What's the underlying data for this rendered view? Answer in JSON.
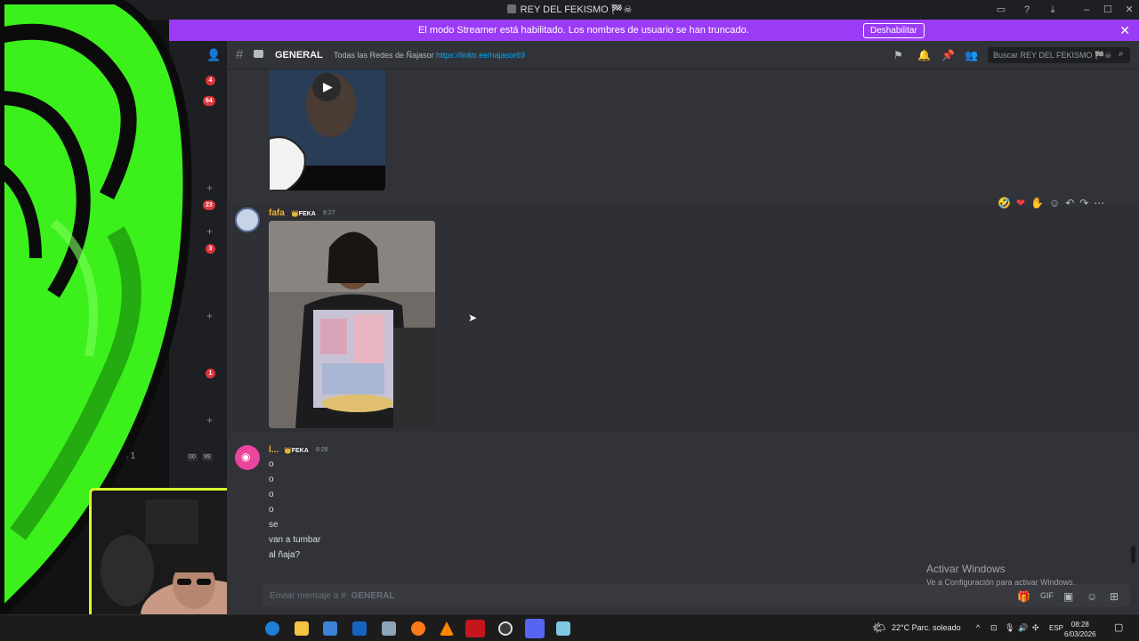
{
  "window": {
    "title": "REY DEL FEKISMO 🏁☠"
  },
  "banner": {
    "message": "El modo Streamer está habilitado. Los nombres de usuario se han truncado.",
    "button_label": "Deshabilitar"
  },
  "rail": {
    "badges": [
      "4",
      "64",
      "23",
      "3",
      "1"
    ],
    "truncated_channel": "...o 1",
    "voice_stats": [
      "00",
      "99"
    ]
  },
  "header": {
    "channel_name": "GENERAL",
    "topic_text": "Todas las Redes de Ñajasor",
    "topic_link": "https://linktr.ee/najasor69",
    "search_placeholder": "Buscar REY DEL FEKISMO 🏁☠"
  },
  "messages": [
    {
      "author": "fafa",
      "tag": "FEKA",
      "time": "8:27",
      "author_color": "#f0b232"
    },
    {
      "author": "l...",
      "tag": "FEKA",
      "time": "8:28",
      "author_color": "#f0b232",
      "lines": [
        "o",
        "o",
        "o",
        "o",
        "se",
        "van a tumbar",
        "al ñaja?"
      ]
    }
  ],
  "composer": {
    "placeholder": "Enviar mensaje a #",
    "channel": "GENERAL"
  },
  "watermark": {
    "line1": "Activar Windows",
    "line2": "Ve a Configuración para activar Windows."
  },
  "taskbar": {
    "weather": "22°C  Parc. soleado",
    "language": "ESP",
    "time": "08:28",
    "date": "6/03/2026"
  },
  "colors": {
    "banner": "#9b3bf5",
    "accent_green": "#3cf01c",
    "webcam_border": "#d7ff2a"
  }
}
